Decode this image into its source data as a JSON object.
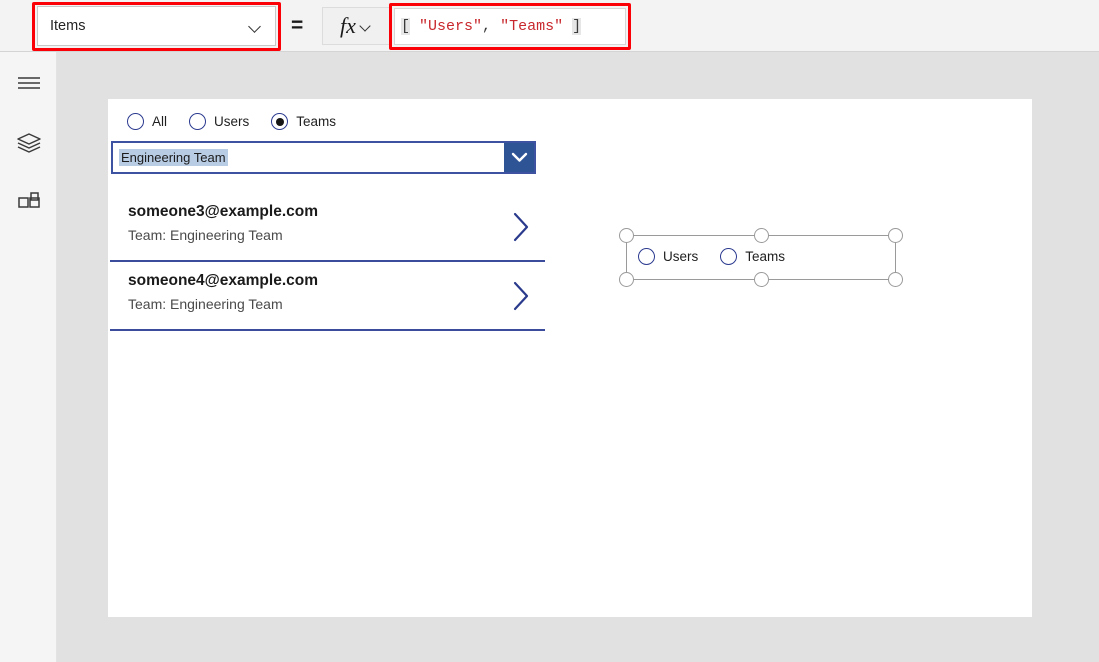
{
  "formula_bar": {
    "property_dropdown": {
      "value": "Items",
      "icon": "chevron-down-icon"
    },
    "equals": "=",
    "fx": {
      "glyph": "fx",
      "icon": "chevron-down-icon"
    },
    "formula": {
      "open_bracket": "[",
      "string_1": "\"Users\"",
      "comma": ", ",
      "string_2": "\"Teams\"",
      "close_bracket": "]",
      "full_text": "[ \"Users\", \"Teams\" ]",
      "string_color": "#c8282d",
      "bracket_color": "#3b3b3b",
      "bracket_highlight": "#e6e6e6"
    },
    "annotations": [
      {
        "name": "property-dropdown-highlight",
        "color": "#fb0007"
      },
      {
        "name": "formula-input-highlight",
        "color": "#fb0007"
      }
    ]
  },
  "left_rail": {
    "items": [
      {
        "name": "hamburger-menu-icon",
        "label": "Menu"
      },
      {
        "name": "tree-view-icon",
        "label": "Tree view"
      },
      {
        "name": "insert-components-icon",
        "label": "Insert"
      }
    ]
  },
  "canvas": {
    "radio_group": {
      "options": [
        {
          "label": "All",
          "selected": false
        },
        {
          "label": "Users",
          "selected": false
        },
        {
          "label": "Teams",
          "selected": true
        }
      ],
      "selected_value": "Teams",
      "accent_color": "#2b3a8f"
    },
    "combobox": {
      "value": "Engineering Team",
      "icon": "chevron-down-icon",
      "border_color": "#3d52a0",
      "button_color": "#2f5496",
      "highlight_color": "#b8cce4"
    },
    "gallery": {
      "separator_color": "#3b4c9c",
      "chevron_color": "#2a3a8c",
      "items": [
        {
          "title": "someone3@example.com",
          "subtitle": "Team: Engineering Team",
          "chevron": "chevron-right-icon"
        },
        {
          "title": "someone4@example.com",
          "subtitle": "Team: Engineering Team",
          "chevron": "chevron-right-icon"
        }
      ]
    },
    "selected_control": {
      "type": "radio-group",
      "options": [
        {
          "label": "Users",
          "selected": false
        },
        {
          "label": "Teams",
          "selected": false
        }
      ],
      "handles": [
        "top-left",
        "top-middle",
        "top-right",
        "bottom-left",
        "bottom-middle",
        "bottom-right"
      ],
      "border_color": "#9a9a9a"
    }
  }
}
